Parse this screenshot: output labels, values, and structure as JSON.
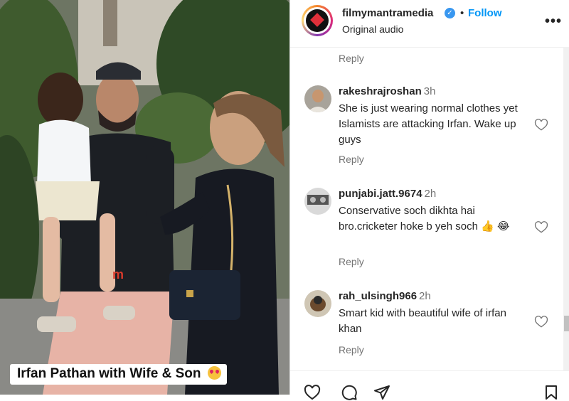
{
  "post": {
    "caption": "Irfan Pathan with Wife & Son",
    "caption_emoji": "heart-eyes-emoji",
    "watermark": "m"
  },
  "header": {
    "username": "filmymantramedia",
    "separator": "•",
    "follow_label": "Follow",
    "subtitle": "Original audio",
    "more_label": "•••"
  },
  "comments": {
    "top_reply_label": "Reply",
    "items": [
      {
        "user": "rakeshrajroshan",
        "time": "3h",
        "text": "She is just wearing normal clothes yet Islamists are attacking Irfan. Wake up guys",
        "reply_label": "Reply"
      },
      {
        "user": "punjabi.jatt.9674",
        "time": "2h",
        "text": "Conservative soch dikhta hai bro.cricketer hoke b yeh soch 👍 😂",
        "reply_label": "Reply"
      },
      {
        "user": "rah_ulsingh966",
        "time": "2h",
        "text": "Smart kid with beautiful wife of irfan khan",
        "reply_label": "Reply"
      }
    ]
  },
  "actions": [
    "like-icon",
    "comment-icon",
    "share-icon",
    "save-icon"
  ],
  "colors": {
    "accent": "#0095f6",
    "verified": "#3897f0",
    "muted": "#737373"
  }
}
